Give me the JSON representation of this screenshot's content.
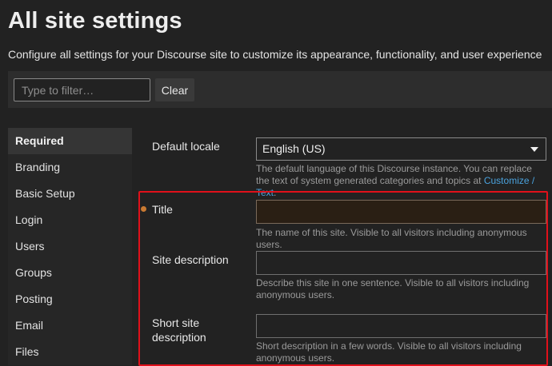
{
  "header": {
    "title": "All site settings",
    "subtitle": "Configure all settings for your Discourse site to customize its appearance, functionality, and user experience"
  },
  "filter": {
    "placeholder": "Type to filter…",
    "value": "",
    "clear_label": "Clear"
  },
  "sidebar": {
    "items": [
      {
        "label": "Required",
        "active": true
      },
      {
        "label": "Branding"
      },
      {
        "label": "Basic Setup"
      },
      {
        "label": "Login"
      },
      {
        "label": "Users"
      },
      {
        "label": "Groups"
      },
      {
        "label": "Posting"
      },
      {
        "label": "Email"
      },
      {
        "label": "Files"
      }
    ]
  },
  "settings": {
    "default_locale": {
      "label": "Default locale",
      "value": "English (US)",
      "desc_before": "The default language of this Discourse instance. You can replace the text of system generated categories and topics at ",
      "desc_link": "Customize / Text",
      "desc_after": "."
    },
    "title": {
      "label": "Title",
      "value": "",
      "desc": "The name of this site. Visible to all visitors including anonymous users."
    },
    "site_description": {
      "label": "Site description",
      "value": "",
      "desc": "Describe this site in one sentence. Visible to all visitors including anonymous users."
    },
    "short_site_description": {
      "label": "Short site description",
      "value": "",
      "desc": "Short description in a few words. Visible to all visitors including anonymous users."
    }
  },
  "colors": {
    "highlight": "#e0101a",
    "required_dot": "#c97a32",
    "link": "#4aa3df"
  }
}
